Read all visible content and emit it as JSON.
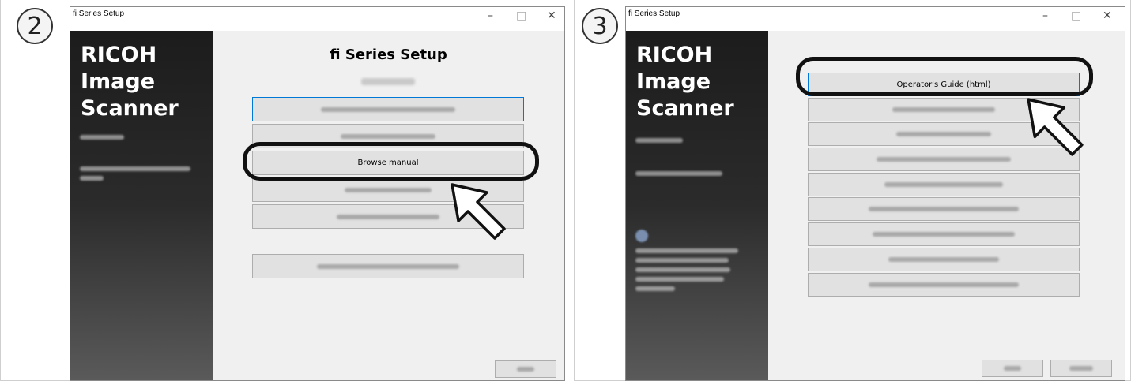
{
  "step_left": {
    "badge": "2"
  },
  "step_right": {
    "badge": "3"
  },
  "left_window": {
    "title": "fi Series Setup",
    "controls": {
      "minimize": "–",
      "maximize": "□",
      "close": "✕"
    },
    "brand_lines": [
      "RICOH",
      "Image",
      "Scanner"
    ],
    "heading": "fi Series Setup",
    "highlighted_button": "Browse manual"
  },
  "right_window": {
    "title": "fi Series Setup",
    "controls": {
      "minimize": "–",
      "maximize": "□",
      "close": "✕"
    },
    "brand_lines": [
      "RICOH",
      "Image",
      "Scanner"
    ],
    "highlighted_button": "Operator's Guide (html)"
  },
  "icons": {
    "cursor": "pointer-arrow-icon",
    "info": "info-icon"
  },
  "colors": {
    "accent": "#0078d7",
    "highlight_ring": "#111111",
    "sidebar_dark": "#1c1c1c"
  }
}
